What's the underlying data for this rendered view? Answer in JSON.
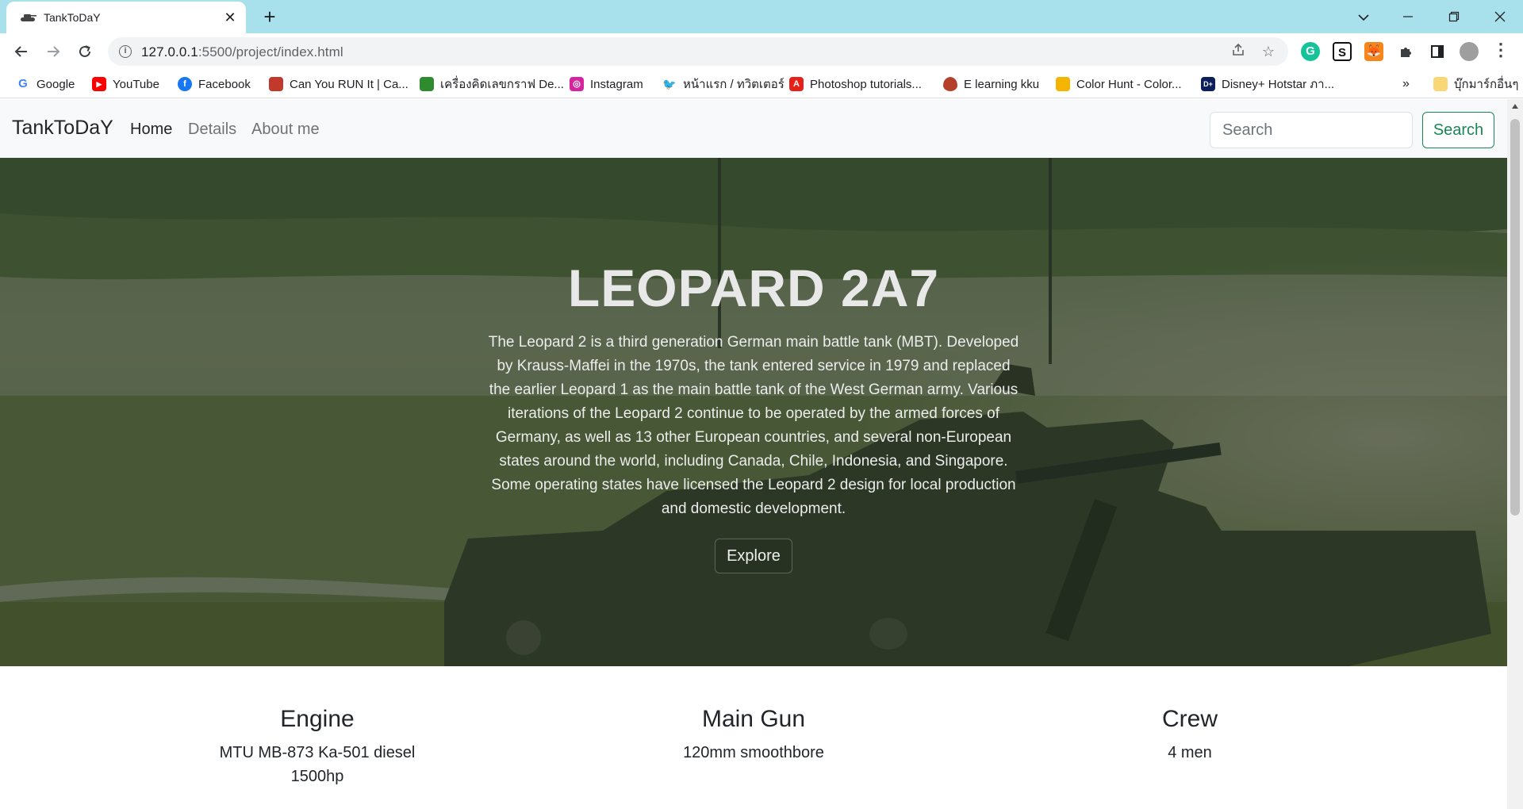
{
  "browser": {
    "tab_title": "TankToDaY",
    "tab_close": "✕",
    "new_tab": "+",
    "url_host": "127.0.0.1",
    "url_path": ":5500/project/index.html",
    "bookmarks": [
      {
        "label": "Google",
        "icon": "google-icon",
        "color": "#ffffff"
      },
      {
        "label": "YouTube",
        "icon": "youtube-icon",
        "color": "#ff0000"
      },
      {
        "label": "Facebook",
        "icon": "facebook-icon",
        "color": "#1877f2"
      },
      {
        "label": "Can You RUN It | Ca...",
        "icon": "canyourunit-icon",
        "color": "#c0392b"
      },
      {
        "label": "เครื่องคิดเลขกราฟ De...",
        "icon": "desmos-icon",
        "color": "#2e8b2e"
      },
      {
        "label": "Instagram",
        "icon": "instagram-icon",
        "color": "#d6249f"
      },
      {
        "label": "หน้าแรก / ทวิตเตอร์",
        "icon": "twitter-icon",
        "color": "#1d9bf0"
      },
      {
        "label": "Photoshop tutorials...",
        "icon": "adobe-icon",
        "color": "#e8201a"
      },
      {
        "label": "E learning kku",
        "icon": "kku-icon",
        "color": "#b5402a"
      },
      {
        "label": "Color Hunt - Color...",
        "icon": "colorhunt-icon",
        "color": "#f4b400"
      },
      {
        "label": "Disney+ Hotstar ภา...",
        "icon": "hotstar-icon",
        "color": "#0c1e5b"
      }
    ],
    "bookmarks_overflow": "»",
    "other_bookmarks": "บุ๊กมาร์กอื่นๆ"
  },
  "navbar": {
    "brand": "TankToDaY",
    "links": [
      "Home",
      "Details",
      "About me"
    ],
    "search_placeholder": "Search",
    "search_button": "Search"
  },
  "hero": {
    "title": "LEOPARD 2A7",
    "description": "The Leopard 2 is a third generation German main battle tank (MBT). Developed by Krauss-Maffei in the 1970s, the tank entered service in 1979 and replaced the earlier Leopard 1 as the main battle tank of the West German army. Various iterations of the Leopard 2 continue to be operated by the armed forces of Germany, as well as 13 other European countries, and several non-European states around the world, including Canada, Chile, Indonesia, and Singapore. Some operating states have licensed the Leopard 2 design for local production and domestic development.",
    "button": "Explore"
  },
  "specs": [
    {
      "title": "Engine",
      "line1": "MTU MB-873 Ka-501 diesel",
      "line2": "1500hp"
    },
    {
      "title": "Main Gun",
      "line1": "120mm smoothbore",
      "line2": ""
    },
    {
      "title": "Crew",
      "line1": "4 men",
      "line2": ""
    }
  ]
}
